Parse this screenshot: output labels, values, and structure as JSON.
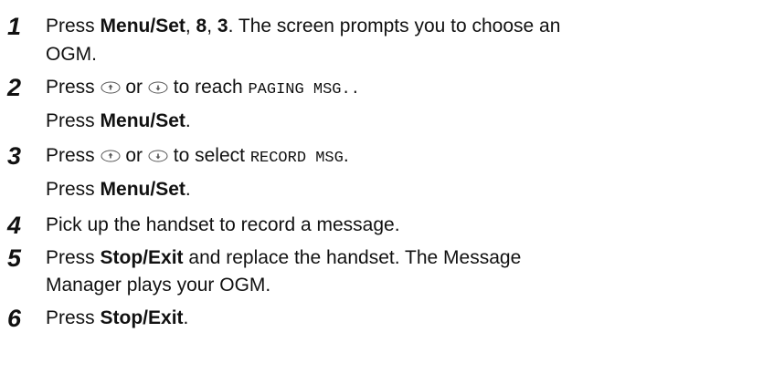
{
  "steps": [
    {
      "number": "1",
      "press": "Press",
      "menu_set": "Menu/Set",
      "comma1": ", ",
      "digit1": "8",
      "comma2": ", ",
      "digit2": "3",
      "text_after": ". The screen prompts you to choose an",
      "text_line2": "OGM."
    },
    {
      "number": "2",
      "press": "Press",
      "or": "or",
      "to_reach": "to reach",
      "lcd": "PAGING MSG..",
      "press2": "Press",
      "menu_set": "Menu/Set",
      "period": "."
    },
    {
      "number": "3",
      "press": "Press",
      "or": "or",
      "to_select": "to select",
      "lcd": "RECORD MSG",
      "period": ".",
      "press2": "Press",
      "menu_set": "Menu/Set",
      "period2": "."
    },
    {
      "number": "4",
      "text": "Pick up the handset to record a message."
    },
    {
      "number": "5",
      "press": "Press",
      "stop_exit": "Stop/Exit",
      "text_after": "and replace the handset. The Message",
      "text_line2": "Manager plays your OGM."
    },
    {
      "number": "6",
      "press": "Press",
      "stop_exit": "Stop/Exit",
      "period": "."
    }
  ],
  "icons": {
    "up": "navigation-up-arrow-icon",
    "down": "navigation-down-arrow-icon"
  }
}
